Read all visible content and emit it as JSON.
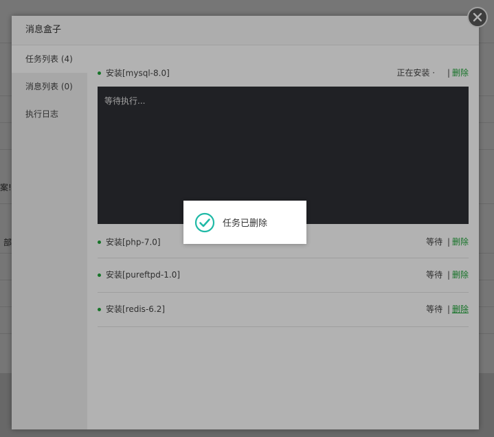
{
  "background": {
    "fragments": [
      "案!",
      "部"
    ]
  },
  "modal": {
    "title": "消息盒子",
    "close_icon": "close-icon"
  },
  "sidebar": {
    "items": [
      {
        "label": "任务列表 (4)",
        "active": true
      },
      {
        "label": "消息列表 (0)",
        "active": false
      },
      {
        "label": "执行日志",
        "active": false
      }
    ]
  },
  "tasks": {
    "current": {
      "name": "安装[mysql-8.0]",
      "status": "正在安装 ·",
      "separator": "|",
      "delete_label": "删除",
      "console_text": "等待执行..."
    },
    "queue": [
      {
        "name": "安装[php-7.0]",
        "status": "等待",
        "separator": "|",
        "delete_label": "删除"
      },
      {
        "name": "安装[pureftpd-1.0]",
        "status": "等待",
        "separator": "|",
        "delete_label": "删除"
      },
      {
        "name": "安装[redis-6.2]",
        "status": "等待",
        "separator": "|",
        "delete_label": "删除"
      }
    ]
  },
  "toast": {
    "message": "任务已删除",
    "icon": "check-circle-icon"
  },
  "colors": {
    "accent": "#20a53a",
    "console_bg": "#2f3036"
  }
}
